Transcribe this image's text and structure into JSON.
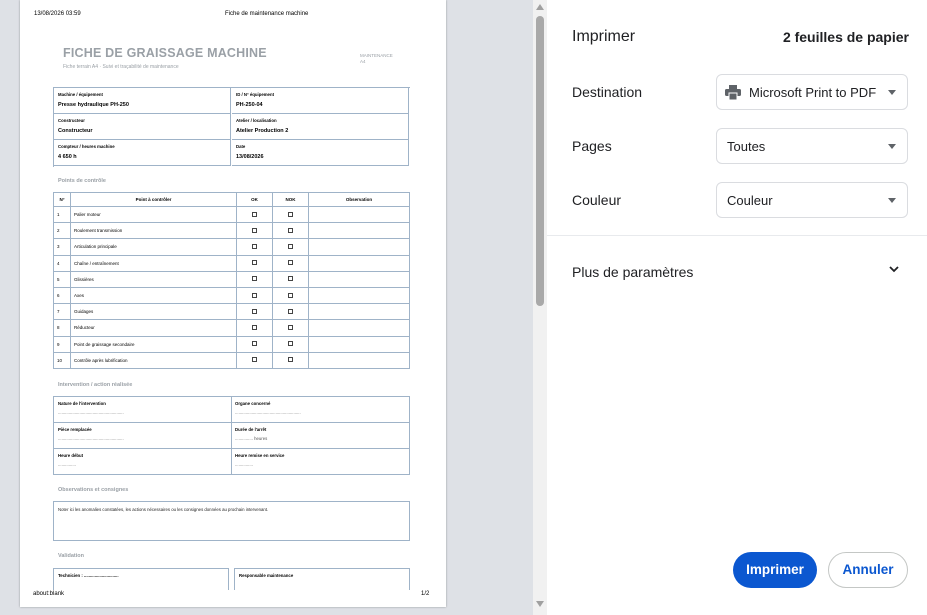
{
  "preview": {
    "header_datetime": "13/08/2026 03:59",
    "header_title": "Fiche de maintenance machine",
    "footer_url": "about:blank",
    "footer_page": "1/2",
    "doc": {
      "title": "FICHE DE GRAISSAGE MACHINE",
      "subtitle": "Fiche terrain A4 · Suivi et traçabilité de maintenance",
      "tag_line1": "MAINTENANCE",
      "tag_line2": "A4",
      "info": [
        {
          "label": "Machine / équipement",
          "value": "Presse hydraulique PH-250"
        },
        {
          "label": "ID / N° équipement",
          "value": "PH-250-04"
        },
        {
          "label": "Constructeur",
          "value": "Constructeur"
        },
        {
          "label": "Atelier / localisation",
          "value": "Atelier Production 2"
        },
        {
          "label": "Compteur / heures machine",
          "value": "4 650 h"
        },
        {
          "label": "Date",
          "value": "13/08/2026"
        }
      ],
      "section_checkpoints": "Points de contrôle",
      "table_headers": [
        "N°",
        "Point à contrôler",
        "OK",
        "NOK",
        "Observation"
      ],
      "checkpoints": [
        {
          "n": "1",
          "item": "Palier moteur"
        },
        {
          "n": "2",
          "item": "Roulement transmission"
        },
        {
          "n": "3",
          "item": "Articulation principale"
        },
        {
          "n": "4",
          "item": "Chaîne / entraînement"
        },
        {
          "n": "5",
          "item": "Glissières"
        },
        {
          "n": "6",
          "item": "Axes"
        },
        {
          "n": "7",
          "item": "Guidages"
        },
        {
          "n": "8",
          "item": "Réducteur"
        },
        {
          "n": "9",
          "item": "Point de graissage secondaire"
        },
        {
          "n": "10",
          "item": "Contrôle après lubrification"
        }
      ],
      "section_intervention": "Intervention / action réalisée",
      "intervention": [
        {
          "label": "Nature de l'intervention",
          "line": "......................................................."
        },
        {
          "label": "Organe concerné",
          "line": "......................................................."
        },
        {
          "label": "Pièce remplacée",
          "line": "......................................................."
        },
        {
          "label": "Durée de l'arrêt",
          "line": "............... heures"
        },
        {
          "label": "Heure début",
          "line": "..............."
        },
        {
          "label": "Heure remise en service",
          "line": "..............."
        }
      ],
      "section_observations": "Observations et consignes",
      "observations_text": "Noter ici les anomalies constatées, les actions nécessaires ou les consignes données au prochain intervenant.",
      "section_validation": "Validation",
      "technicien_label": "Technicien : .............................",
      "responsable_label": "Responsable maintenance"
    }
  },
  "panel": {
    "title": "Imprimer",
    "sheet_count": "2 feuilles de papier",
    "destination_label": "Destination",
    "destination_value": "Microsoft Print to PDF",
    "pages_label": "Pages",
    "pages_value": "Toutes",
    "color_label": "Couleur",
    "color_value": "Couleur",
    "more_settings": "Plus de paramètres",
    "print_button": "Imprimer",
    "cancel_button": "Annuler"
  },
  "colors": {
    "accent": "#0b57d0",
    "preview_bg": "#dee1e6"
  }
}
